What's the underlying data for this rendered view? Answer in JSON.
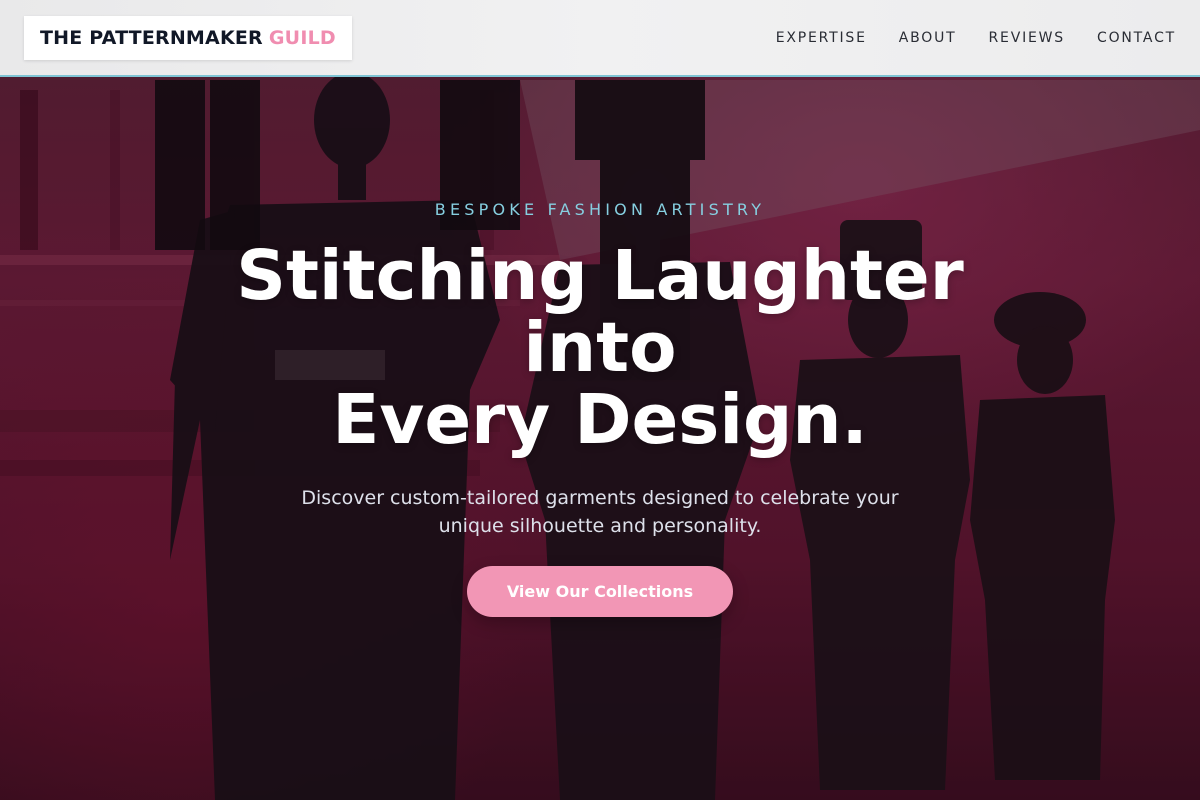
{
  "header": {
    "logo": {
      "main": "THE PATTERNMAKER",
      "accent": "GUILD"
    },
    "nav": [
      {
        "label": "EXPERTISE"
      },
      {
        "label": "ABOUT"
      },
      {
        "label": "REVIEWS"
      },
      {
        "label": "CONTACT"
      }
    ]
  },
  "hero": {
    "eyebrow": "BESPOKE FASHION ARTISTRY",
    "headline_lines": [
      "Stitching Laughter",
      "into",
      "Every Design."
    ],
    "subtitle": "Discover custom-tailored garments designed to celebrate your unique silhouette and personality.",
    "cta_label": "View Our Collections",
    "background_image": "mannequins-in-dark-dresses-against-magenta-wall"
  },
  "colors": {
    "accent_pink": "#f296b5",
    "eyebrow_blue": "#86cfe0",
    "header_border": "#7fc4d4",
    "logo_text": "#111827",
    "hero_bg": "#6b1d3a"
  }
}
